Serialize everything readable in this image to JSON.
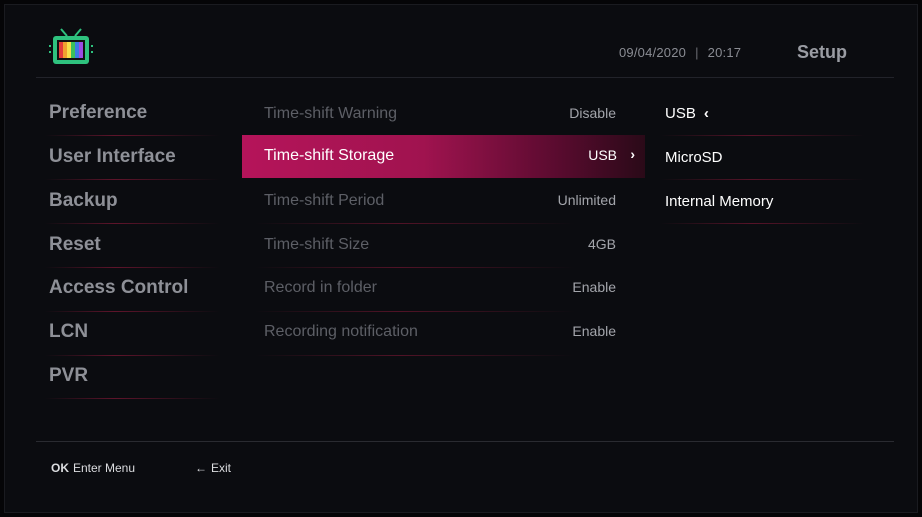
{
  "header": {
    "date": "09/04/2020",
    "separator": "|",
    "time": "20:17",
    "title": "Setup",
    "logo_icon": "tv-icon"
  },
  "menu": {
    "items": [
      {
        "label": "Preference"
      },
      {
        "label": "User Interface"
      },
      {
        "label": "Backup"
      },
      {
        "label": "Reset"
      },
      {
        "label": "Access Control"
      },
      {
        "label": "LCN"
      },
      {
        "label": "PVR"
      }
    ]
  },
  "settings": {
    "rows": [
      {
        "label": "Time-shift Warning",
        "value": "Disable"
      },
      {
        "label": "Time-shift Storage",
        "value": "USB",
        "selected": true
      },
      {
        "label": "Time-shift Period",
        "value": "Unlimited"
      },
      {
        "label": "Time-shift Size",
        "value": "4GB"
      },
      {
        "label": "Record in folder",
        "value": "Enable"
      },
      {
        "label": "Recording notification",
        "value": "Enable"
      }
    ]
  },
  "options": {
    "items": [
      {
        "label": "USB",
        "current": true
      },
      {
        "label": "MicroSD"
      },
      {
        "label": "Internal Memory"
      }
    ]
  },
  "footer": {
    "ok_key": "OK",
    "ok_label": "Enter Menu",
    "exit_key": "←",
    "exit_label": "Exit"
  },
  "colors": {
    "accent": "#b5145a",
    "background": "#0b0c10"
  }
}
